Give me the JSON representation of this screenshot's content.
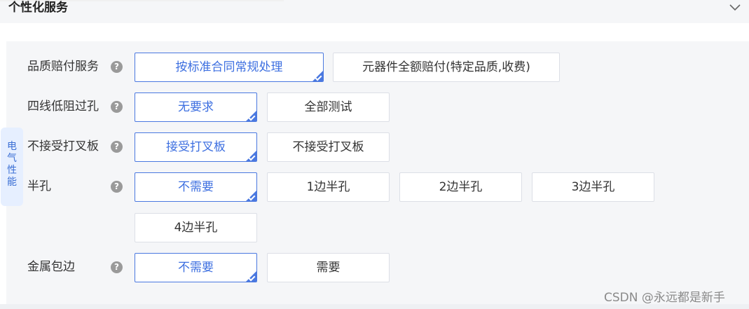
{
  "header": {
    "title": "个性化服务",
    "collapse_icon": "chevron-down-icon"
  },
  "side_tab": {
    "chars": [
      "电",
      "气",
      "性",
      "能"
    ]
  },
  "rows": [
    {
      "label": "品质赔付服务",
      "help": "?",
      "options": [
        "按标准合同常规处理",
        "元器件全额赔付(特定品质,收费)"
      ],
      "selected": 0
    },
    {
      "label": "四线低阻过孔",
      "help": "?",
      "options": [
        "无要求",
        "全部测试"
      ],
      "selected": 0
    },
    {
      "label": "不接受打叉板",
      "help": "?",
      "options": [
        "接受打叉板",
        "不接受打叉板"
      ],
      "selected": 0
    },
    {
      "label": "半孔",
      "help": "?",
      "options": [
        "不需要",
        "1边半孔",
        "2边半孔",
        "3边半孔",
        "4边半孔"
      ],
      "selected": 0
    },
    {
      "label": "金属包边",
      "help": "?",
      "options": [
        "不需要",
        "需要"
      ],
      "selected": 0
    }
  ],
  "colors": {
    "accent": "#4a78e0",
    "panel_bg": "#f5f6f8",
    "tab_bg": "#e6efff"
  },
  "watermark": "CSDN @永远都是新手"
}
